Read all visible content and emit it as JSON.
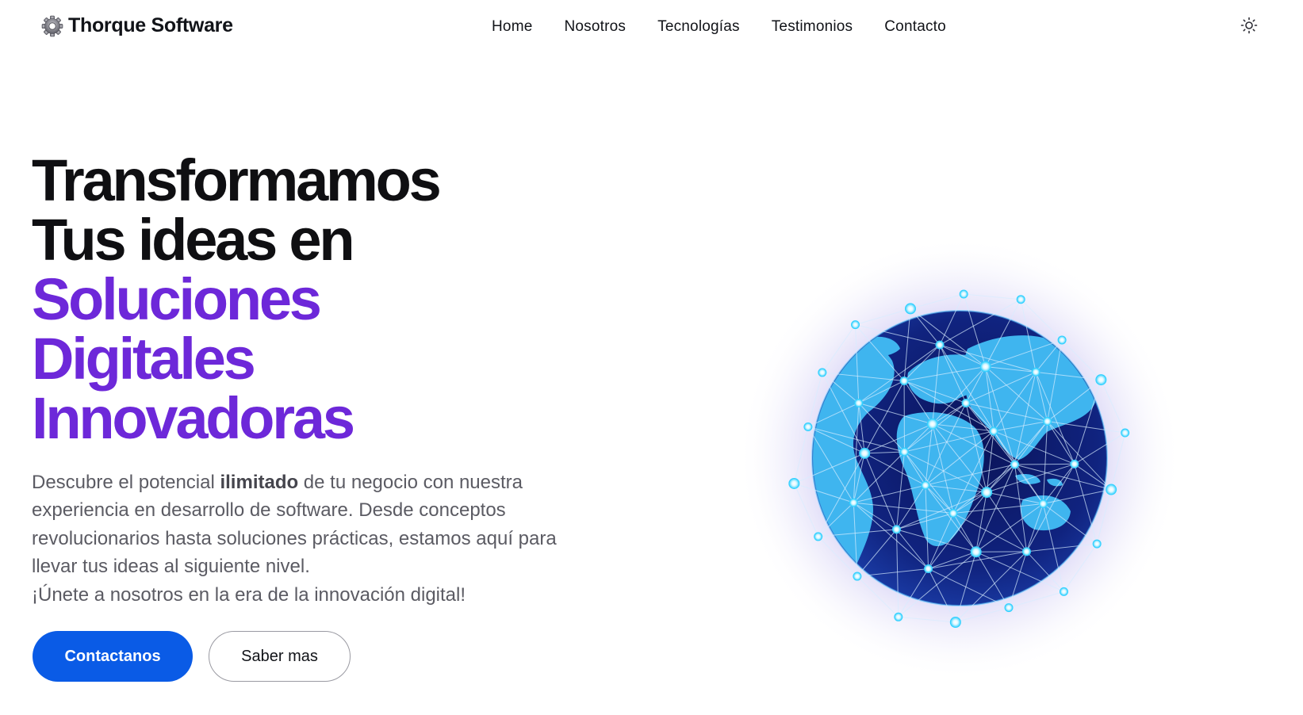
{
  "brand": {
    "name": "Thorque Software",
    "icon": "gear-icon"
  },
  "nav": {
    "items": [
      {
        "label": "Home"
      },
      {
        "label": "Nosotros"
      },
      {
        "label": "Tecnologías"
      },
      {
        "label": "Testimonios"
      },
      {
        "label": "Contacto"
      }
    ]
  },
  "theme_toggle": {
    "icon": "sun-icon"
  },
  "hero": {
    "title_lines": [
      "Transformamos",
      "Tus ideas en"
    ],
    "title_accent_lines": [
      "Soluciones",
      "Digitales",
      "Innovadoras"
    ],
    "description": {
      "part1": "Descubre el potencial ",
      "bold": "ilimitado",
      "part2": " de tu negocio con nuestra experiencia en desarrollo de software. Desde conceptos revolucionarios hasta soluciones prácticas, estamos aquí para llevar tus ideas al siguiente nivel.",
      "line2": "¡Únete a nosotros en la era de la innovación digital!"
    },
    "primary_button": "Contactanos",
    "secondary_button": "Saber mas",
    "illustration_icon": "network-globe-icon"
  },
  "colors": {
    "accent_purple": "#6d28d9",
    "primary_blue": "#0a5be6",
    "text_dark": "#0f0f12",
    "text_muted": "#5b5b63",
    "globe_ocean": "#0b1a6e",
    "globe_land": "#3fb5ef",
    "network_nodes": "#2fd0ff"
  }
}
